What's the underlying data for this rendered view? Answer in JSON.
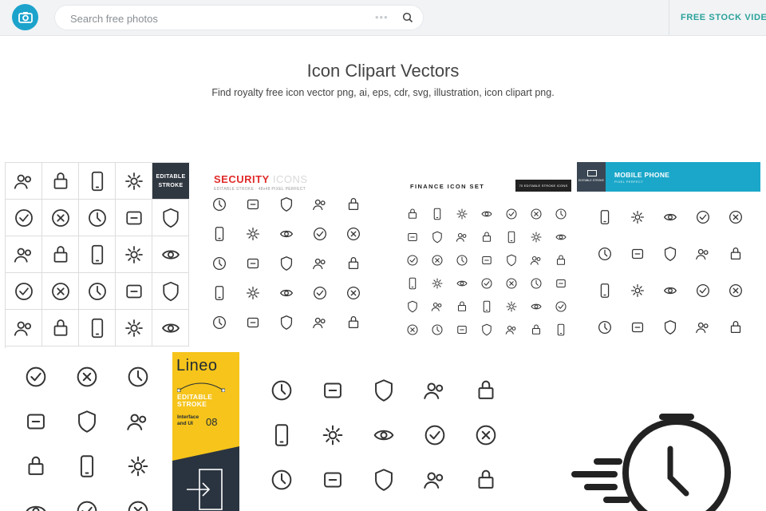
{
  "header": {
    "search_placeholder": "Search free photos",
    "dots": "•••",
    "videos_link": "FREE STOCK VIDEOS"
  },
  "page": {
    "title": "Icon Clipart Vectors",
    "subtitle": "Find royalty free icon vector png, ai, eps, cdr, svg, illustration, icon clipart png."
  },
  "tiles": {
    "editable_stroke_badge": "EDITABLE STROKE",
    "security": {
      "title_a": "SECURITY",
      "title_b": " ICONS",
      "sub": "EDITABLE STROKE · 48x48 PIXEL PERFECT"
    },
    "finance": {
      "title": "FINANCE ICON SET",
      "badge": "70 EDITABLE STROKE ICONS"
    },
    "mobile": {
      "title": "MOBILE PHONE",
      "sub": "PIXEL PERFECT",
      "logo_text": "EDITABLE STROKE"
    },
    "lineo": {
      "brand": "Lineo",
      "editable": "EDITABLE STROKE",
      "sub": "Interface and UI",
      "num": "08"
    }
  },
  "colors": {
    "accent": "#1ca3cc",
    "teal_link": "#2aa29a",
    "lineo_yellow": "#f6c41b",
    "mobile_blue": "#1ba7c9",
    "security_red": "#e02b2b"
  }
}
